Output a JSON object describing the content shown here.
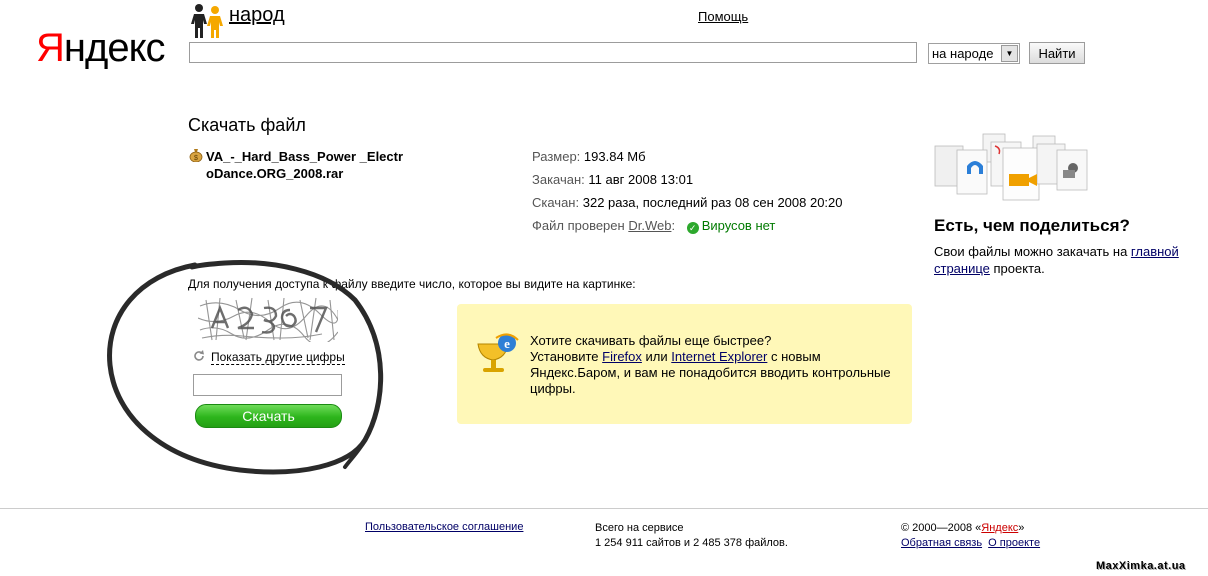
{
  "header": {
    "logo_first": "Я",
    "logo_rest": "ндекс",
    "service_name": "народ",
    "help_label": "Помощь",
    "search_value": "",
    "scope_value": "на народе",
    "find_label": "Найти"
  },
  "file": {
    "page_title": "Скачать файл",
    "name": "VA_-_Hard_Bass_Power _ElectroDance.ORG_2008.rar",
    "size_key": "Размер:",
    "size_val": "193.84 Мб",
    "uploaded_key": "Закачан:",
    "uploaded_val": "11 авг 2008 13:01",
    "downloaded_key": "Скачан:",
    "downloaded_val": "322 раза, последний раз 08 сен 2008 20:20",
    "checked_key": "Файл проверен",
    "checker_link": "Dr.Web",
    "checked_colon": ":",
    "virus_status": "Вирусов нет"
  },
  "share": {
    "title": "Есть, чем поделиться?",
    "text_before": "Свои файлы можно закачать на",
    "link": "главной странице",
    "text_after": "проекта."
  },
  "captcha": {
    "prompt": "Для получения доступа к файлу введите число, которое вы видите на картинке:",
    "refresh_label": "Показать другие цифры",
    "input_value": "",
    "download_label": "Скачать"
  },
  "promo": {
    "line1": "Хотите скачивать файлы еще быстрее?",
    "install": "Установите",
    "firefox": "Firefox",
    "or": "или",
    "ie": "Internet Explorer",
    "with_new": "с новым",
    "rest": "Яндекс.Баром, и вам не понадобится вводить контрольные цифры."
  },
  "footer": {
    "agreement": "Пользовательское соглашение",
    "stats_line1": "Всего на сервисе",
    "stats_line2": "1 254 911 сайтов и 2 485 378 файлов.",
    "copyright_prefix": "© 2000—2008 «",
    "copyright_brand": "Яндекс",
    "copyright_suffix": "»",
    "feedback": "Обратная связь",
    "about": "О проекте"
  },
  "watermark": "MaxXimka.at.ua",
  "colors": {
    "accent_red": "#ff0000",
    "link": "#000066",
    "promo_bg": "#fff8b8",
    "download_green": "#2db51c",
    "virus_ok": "#007a00"
  }
}
